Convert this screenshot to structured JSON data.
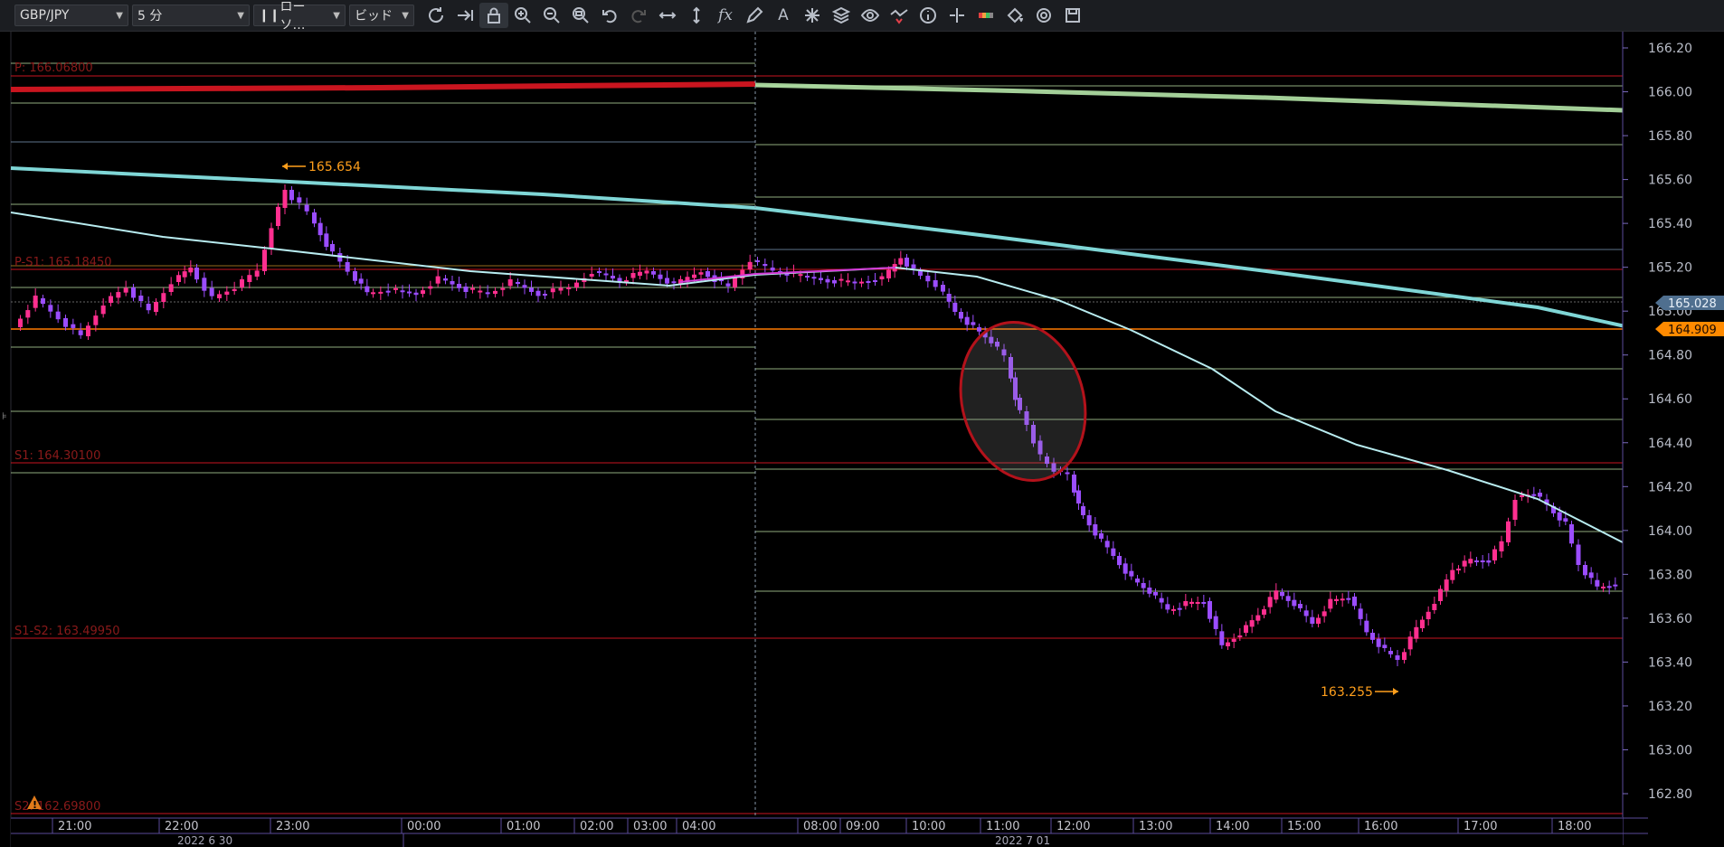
{
  "toolbar": {
    "symbol": "GBP/JPY",
    "timeframe": "5 分",
    "chart_type": "ローソ…",
    "price_side": "ビッド"
  },
  "chart": {
    "price_axis": [
      "166.20",
      "166.00",
      "165.80",
      "165.60",
      "165.40",
      "165.20",
      "165.00",
      "164.80",
      "164.60",
      "164.40",
      "164.20",
      "164.00",
      "163.80",
      "163.60",
      "163.40",
      "163.20",
      "163.00",
      "162.80"
    ],
    "current_price_tags": {
      "upper": "165.028",
      "lower": "164.909"
    },
    "pivot_labels": {
      "p": "P: 166.06800",
      "p_s1": "P-S1: 165.18450",
      "s1": "S1: 164.30100",
      "s1_s2": "S1-S2: 163.49950",
      "s2": "S2: 162.69800"
    },
    "markers": {
      "high": "165.654",
      "low": "163.255"
    },
    "time_axis": [
      "21:00",
      "22:00",
      "23:00",
      "00:00",
      "01:00",
      "02:00",
      "03:00",
      "04:00",
      "08:00",
      "09:00",
      "10:00",
      "11:00",
      "12:00",
      "13:00",
      "14:00",
      "15:00",
      "16:00",
      "17:00",
      "18:00"
    ],
    "date_labels": {
      "d1": "2022 6 30",
      "d2": "2022 7 01"
    },
    "colors": {
      "bull": "#ff2f8f",
      "bear": "#9b4dff",
      "ma_fast": "#b8ecf0",
      "ma_slow": "#7fd6d6",
      "ma_long": "#b5e6a8",
      "pivot_red": "#c9151f",
      "orange": "#ff9f1c",
      "ellipse": "#b3121b"
    }
  }
}
